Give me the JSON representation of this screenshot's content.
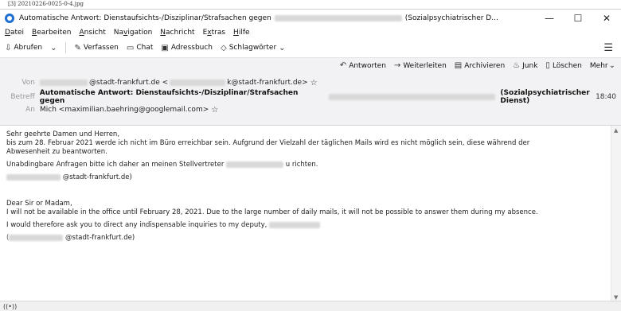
{
  "caption": "[3] 20210226-0025-0-4.jpg",
  "window": {
    "title_prefix": "Automatische Antwort: Dienstaufsichts-/Disziplinar/Strafsachen gegen",
    "title_suffix": "(Sozialpsychiatrischer D...",
    "minimize": "—",
    "maximize": "☐",
    "close": "✕"
  },
  "menu": [
    "Datei",
    "Bearbeiten",
    "Ansicht",
    "Navigation",
    "Nachricht",
    "Extras",
    "Hilfe"
  ],
  "toolbar": {
    "fetch": "Abrufen",
    "compose": "Verfassen",
    "chat": "Chat",
    "addressbook": "Adressbuch",
    "tags": "Schlagwörter"
  },
  "actions": {
    "reply": "Antworten",
    "forward": "Weiterleiten",
    "archive": "Archivieren",
    "junk": "Junk",
    "delete": "Löschen",
    "more": "Mehr"
  },
  "header": {
    "from_label": "Von",
    "from_domain": "@stadt-frankfurt.de <",
    "from_email_tail": "k@stadt-frankfurt.de>",
    "subject_label": "Betreff",
    "subject": "Automatische Antwort: Dienstaufsichts-/Disziplinar/Strafsachen gegen",
    "subject_tail": "(Sozialpsychiatrischer Dienst)",
    "time": "18:40",
    "to_label": "An",
    "to": "Mich <maximilian.baehring@googlemail.com>"
  },
  "body": {
    "p1_l1": "Sehr geehrte Damen und Herren,",
    "p1_l2": "bis zum 28. Februar 2021 werde ich nicht im Büro erreichbar sein. Aufgrund der Vielzahl der täglichen Mails wird es nicht möglich sein, diese während der",
    "p1_l3": "Abwesenheit zu beantworten.",
    "p2_a": "Unabdingbare Anfragen bitte ich daher an meinen Stellvertreter",
    "p2_b": "u richten.",
    "p3": "@stadt-frankfurt.de)",
    "p4_l1": "Dear Sir or Madam,",
    "p4_l2": "I will not be available in the office until February 28, 2021. Due to the large number of daily mails, it will not be possible to answer them during my absence.",
    "p5": "I would therefore ask you to direct any indispensable inquiries to my deputy,",
    "p6": "@stadt-frankfurt.de)"
  }
}
